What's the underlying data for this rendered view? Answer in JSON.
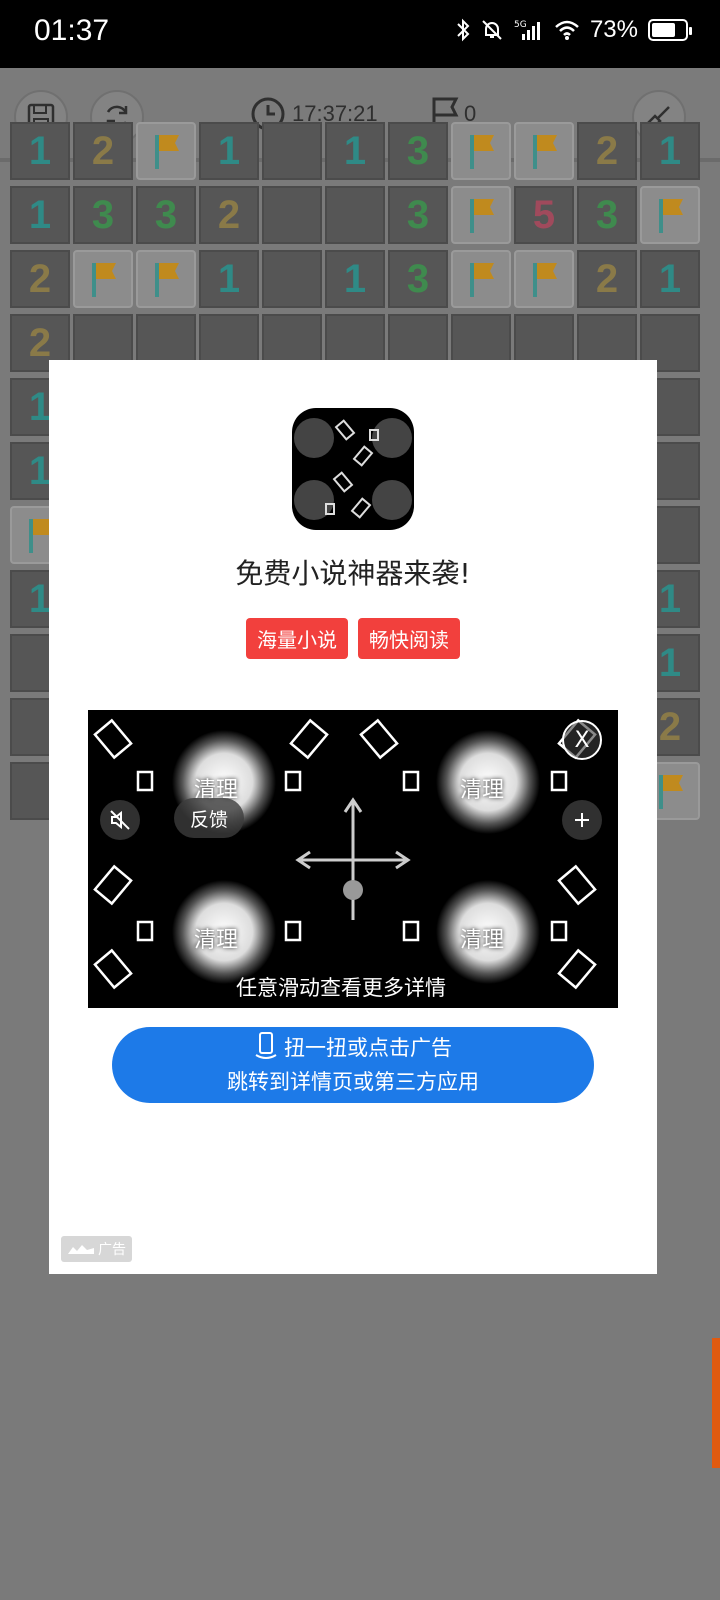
{
  "status_bar": {
    "time": "01:37",
    "battery": "73%",
    "network": "5G"
  },
  "toolbar": {
    "timer": "17:37:21",
    "flag_count": "0"
  },
  "board": {
    "rows": [
      [
        {
          "v": "1"
        },
        {
          "v": "2"
        },
        {
          "v": "F"
        },
        {
          "v": "1"
        },
        {
          "v": ""
        },
        {
          "v": "1"
        },
        {
          "v": "3"
        },
        {
          "v": "F"
        },
        {
          "v": "F"
        },
        {
          "v": "2"
        },
        {
          "v": "1"
        }
      ],
      [
        {
          "v": "1"
        },
        {
          "v": "3"
        },
        {
          "v": "3"
        },
        {
          "v": "2"
        },
        {
          "v": ""
        },
        {
          "v": ""
        },
        {
          "v": "3"
        },
        {
          "v": "F"
        },
        {
          "v": "5"
        },
        {
          "v": "3"
        },
        {
          "v": "F"
        }
      ],
      [
        {
          "v": "2"
        },
        {
          "v": "F"
        },
        {
          "v": "F"
        },
        {
          "v": "1"
        },
        {
          "v": ""
        },
        {
          "v": "1"
        },
        {
          "v": "3"
        },
        {
          "v": "F"
        },
        {
          "v": "F"
        },
        {
          "v": "2"
        },
        {
          "v": "1"
        }
      ],
      [
        {
          "v": "2"
        },
        {
          "v": ""
        },
        {
          "v": ""
        },
        {
          "v": ""
        },
        {
          "v": ""
        },
        {
          "v": ""
        },
        {
          "v": ""
        },
        {
          "v": ""
        },
        {
          "v": ""
        },
        {
          "v": ""
        },
        {
          "v": ""
        }
      ],
      [
        {
          "v": "1"
        },
        {
          "v": ""
        },
        {
          "v": ""
        },
        {
          "v": ""
        },
        {
          "v": ""
        },
        {
          "v": ""
        },
        {
          "v": ""
        },
        {
          "v": ""
        },
        {
          "v": ""
        },
        {
          "v": ""
        },
        {
          "v": ""
        }
      ],
      [
        {
          "v": "1"
        },
        {
          "v": ""
        },
        {
          "v": ""
        },
        {
          "v": ""
        },
        {
          "v": ""
        },
        {
          "v": ""
        },
        {
          "v": ""
        },
        {
          "v": ""
        },
        {
          "v": ""
        },
        {
          "v": ""
        },
        {
          "v": ""
        }
      ],
      [
        {
          "v": "F"
        },
        {
          "v": ""
        },
        {
          "v": ""
        },
        {
          "v": ""
        },
        {
          "v": ""
        },
        {
          "v": ""
        },
        {
          "v": ""
        },
        {
          "v": ""
        },
        {
          "v": ""
        },
        {
          "v": ""
        },
        {
          "v": ""
        }
      ],
      [
        {
          "v": "1"
        },
        {
          "v": ""
        },
        {
          "v": ""
        },
        {
          "v": ""
        },
        {
          "v": ""
        },
        {
          "v": ""
        },
        {
          "v": ""
        },
        {
          "v": ""
        },
        {
          "v": ""
        },
        {
          "v": ""
        },
        {
          "v": "1"
        }
      ],
      [
        {
          "v": ""
        },
        {
          "v": ""
        },
        {
          "v": ""
        },
        {
          "v": ""
        },
        {
          "v": ""
        },
        {
          "v": ""
        },
        {
          "v": ""
        },
        {
          "v": ""
        },
        {
          "v": ""
        },
        {
          "v": ""
        },
        {
          "v": "1"
        }
      ],
      [
        {
          "v": ""
        },
        {
          "v": ""
        },
        {
          "v": ""
        },
        {
          "v": ""
        },
        {
          "v": ""
        },
        {
          "v": ""
        },
        {
          "v": ""
        },
        {
          "v": ""
        },
        {
          "v": ""
        },
        {
          "v": ""
        },
        {
          "v": "2"
        }
      ],
      [
        {
          "v": ""
        },
        {
          "v": ""
        },
        {
          "v": ""
        },
        {
          "v": ""
        },
        {
          "v": ""
        },
        {
          "v": ""
        },
        {
          "v": ""
        },
        {
          "v": ""
        },
        {
          "v": ""
        },
        {
          "v": ""
        },
        {
          "v": "F"
        }
      ]
    ]
  },
  "ad": {
    "title": "免费小说神器来袭!",
    "tags": [
      "海量小说",
      "畅快阅读"
    ],
    "video": {
      "clean_label": "清理",
      "feedback_label": "反馈",
      "swipe_hint": "任意滑动查看更多详情",
      "close_label": "X"
    },
    "cta_line1": "扭一扭或点击广告",
    "cta_line2": "跳转到详情页或第三方应用",
    "ad_mark": "广告"
  }
}
